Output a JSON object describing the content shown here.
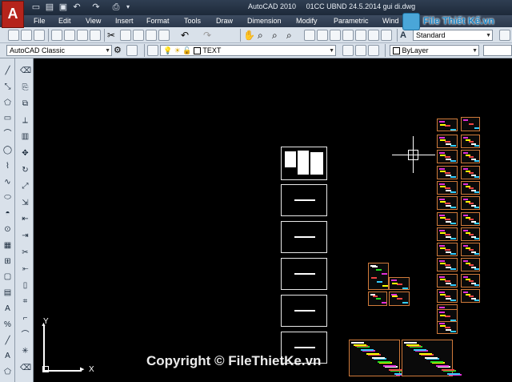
{
  "title_bar": {
    "app_name": "AutoCAD 2010",
    "document": "01CC  UBND 24.5.2014 gui di.dwg",
    "app_logo_letter": "A"
  },
  "quick_access": [
    "new-icon",
    "open-icon",
    "save-icon",
    "undo-icon",
    "redo-icon",
    "plot-icon",
    "dropdown-icon"
  ],
  "menu": [
    "File",
    "Edit",
    "View",
    "Insert",
    "Format",
    "Tools",
    "Draw",
    "Dimension",
    "Modify",
    "Parametric",
    "Wind"
  ],
  "watermark_logo": {
    "text": "File Thiết Kế.vn",
    "color": "#1e86c6"
  },
  "toolbar": {
    "text_style": "Standard",
    "workspace": "AutoCAD Classic",
    "layer": "TEXT",
    "linetype": "ByLayer"
  },
  "ucs": {
    "y_label": "Y",
    "x_label": "X"
  },
  "watermark": "Copyright © FileThietKe.vn",
  "colors": {
    "canvas": "#000000",
    "toolbar": "#d9e1ea",
    "titlebar": "#1d2939",
    "thumb_border": "#d07a3a",
    "accent_magenta": "#e02fd6"
  }
}
